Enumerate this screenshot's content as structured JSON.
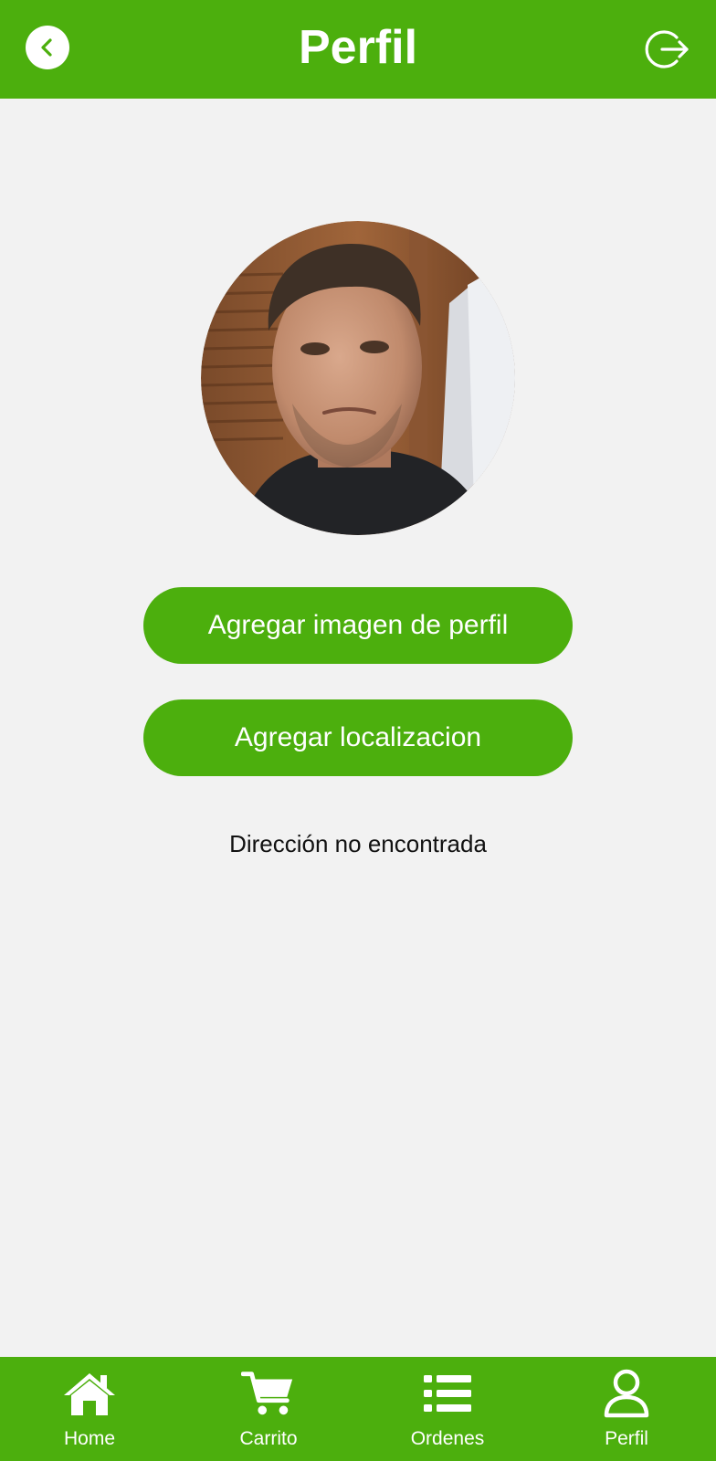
{
  "header": {
    "title": "Perfil",
    "back_icon": "chevron-left-icon",
    "logout_icon": "logout-icon"
  },
  "profile": {
    "avatar": "profile-photo",
    "add_photo_label": "Agregar imagen de perfil",
    "add_location_label": "Agregar localizacion",
    "address_status": "Dirección no encontrada"
  },
  "bottom_nav": {
    "items": [
      {
        "label": "Home",
        "icon": "home-icon"
      },
      {
        "label": "Carrito",
        "icon": "cart-icon"
      },
      {
        "label": "Ordenes",
        "icon": "list-icon"
      },
      {
        "label": "Perfil",
        "icon": "user-icon"
      }
    ]
  },
  "colors": {
    "accent": "#4caf0d",
    "background": "#f2f2f2",
    "text_on_accent": "#ffffff"
  }
}
